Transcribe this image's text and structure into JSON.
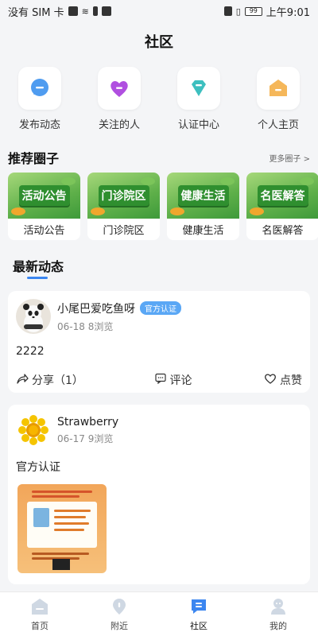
{
  "status_bar": {
    "carrier": "没有 SIM 卡",
    "battery": "99",
    "time": "上午9:01"
  },
  "header": {
    "title": "社区"
  },
  "quick_entries": [
    {
      "label": "发布动态",
      "icon": "chat-bubble-icon",
      "color": "#4f9cf0"
    },
    {
      "label": "关注的人",
      "icon": "heart-icon",
      "color": "#b04fe0"
    },
    {
      "label": "认证中心",
      "icon": "diamond-badge-icon",
      "color": "#3dbfbf"
    },
    {
      "label": "个人主页",
      "icon": "home-icon",
      "color": "#f5b75a"
    }
  ],
  "recommend": {
    "title": "推荐圈子",
    "more": "更多圈子 >",
    "circles": [
      {
        "banner": "活动公告",
        "label": "活动公告"
      },
      {
        "banner": "门诊院区",
        "label": "门诊院区"
      },
      {
        "banner": "健康生活",
        "label": "健康生活"
      },
      {
        "banner": "名医解答",
        "label": "名医解答"
      }
    ]
  },
  "latest": {
    "title": "最新动态"
  },
  "posts": [
    {
      "author": "小尾巴爱吃鱼呀",
      "badge": "官方认证",
      "date": "06-18",
      "views": "8浏览",
      "content": "2222",
      "share": "分享（1）",
      "comment": "评论",
      "like": "点赞"
    },
    {
      "author": "Strawberry",
      "date": "06-17",
      "views": "9浏览",
      "content": "官方认证"
    }
  ],
  "tabs": [
    {
      "label": "首页",
      "icon": "home-tab-icon"
    },
    {
      "label": "附近",
      "icon": "location-pin-icon"
    },
    {
      "label": "社区",
      "icon": "community-icon",
      "active": true
    },
    {
      "label": "我的",
      "icon": "profile-icon"
    }
  ],
  "colors": {
    "accent": "#3b86f0",
    "badge": "#5aa7f5",
    "background": "#f4f5f7"
  }
}
